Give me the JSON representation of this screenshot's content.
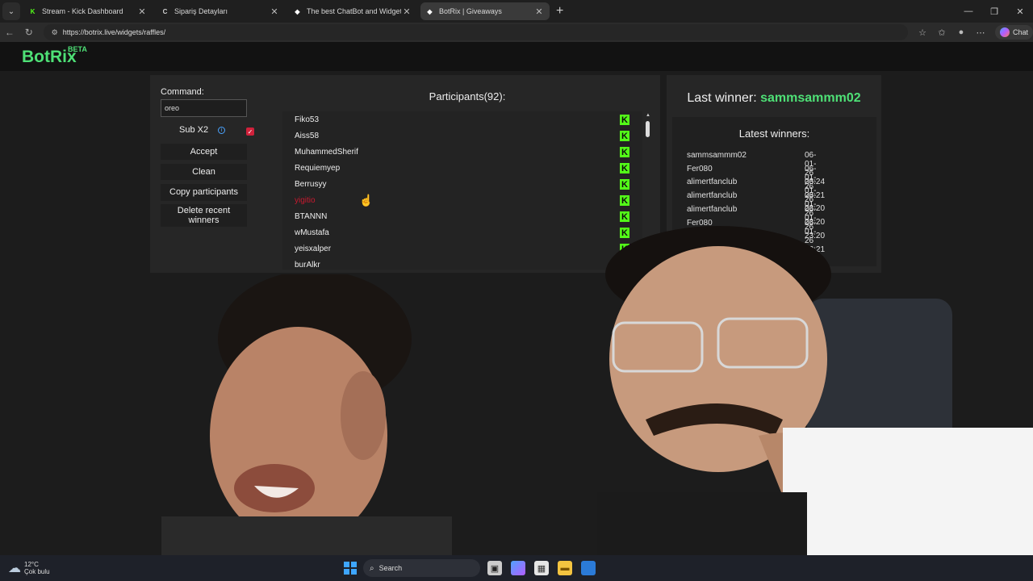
{
  "browser": {
    "tabs": [
      {
        "title": "Stream - Kick Dashboard",
        "favicon": "kick-icon",
        "favicon_text": "K",
        "color": "#53fc18",
        "active": false
      },
      {
        "title": "Sipariş Detayları",
        "favicon": "spinner-icon",
        "favicon_text": "C",
        "color": "#cfcfcf",
        "active": false
      },
      {
        "title": "The best ChatBot and Widgets for",
        "favicon": "botrix-icon",
        "favicon_text": "◆",
        "color": "#ffffff",
        "active": false
      },
      {
        "title": "BotRix | Giveaways",
        "favicon": "botrix-icon",
        "favicon_text": "◆",
        "color": "#ffffff",
        "active": true
      }
    ],
    "url": "https://botrix.live/widgets/raffles/",
    "chat_label": "Chat"
  },
  "app": {
    "logo": "BotRix",
    "badge": "BETA"
  },
  "controls": {
    "command_label": "Command:",
    "command_value": "oreo",
    "sub_label": "Sub X2",
    "sub_checked": true,
    "accept": "Accept",
    "clean": "Clean",
    "copy": "Copy participants",
    "delete": "Delete recent winners"
  },
  "participants": {
    "title": "Participants(92):",
    "items": [
      {
        "name": "Fiko53",
        "highlight": false
      },
      {
        "name": "Aiss58",
        "highlight": false
      },
      {
        "name": "MuhammedSherif",
        "highlight": false
      },
      {
        "name": "Requiemyep",
        "highlight": false
      },
      {
        "name": "Berrusyy",
        "highlight": false
      },
      {
        "name": "yigitio",
        "highlight": true
      },
      {
        "name": "BTANNN",
        "highlight": false
      },
      {
        "name": "wMustafa",
        "highlight": false
      },
      {
        "name": "yeisxalper",
        "highlight": false
      },
      {
        "name": "burAlkr",
        "highlight": false
      }
    ]
  },
  "winners": {
    "last_label": "Last winner:",
    "last_name": "sammsammm02",
    "latest_title": "Latest winners:",
    "list": [
      {
        "name": "sammsammm02",
        "date": "06-01-26 23:24"
      },
      {
        "name": "Fer080",
        "date": "06-01-26 23:21"
      },
      {
        "name": "alimertfanclub",
        "date": "06-01-26 23:20"
      },
      {
        "name": "alimertfanclub",
        "date": "06-01-26 23:20"
      },
      {
        "name": "alimertfanclub",
        "date": "06-01-26 23:20"
      },
      {
        "name": "Fer080",
        "date": "06-01-26 23:21"
      }
    ]
  },
  "taskbar": {
    "temperature": "12°C",
    "weather": "Çok bulu",
    "search": "Search"
  }
}
